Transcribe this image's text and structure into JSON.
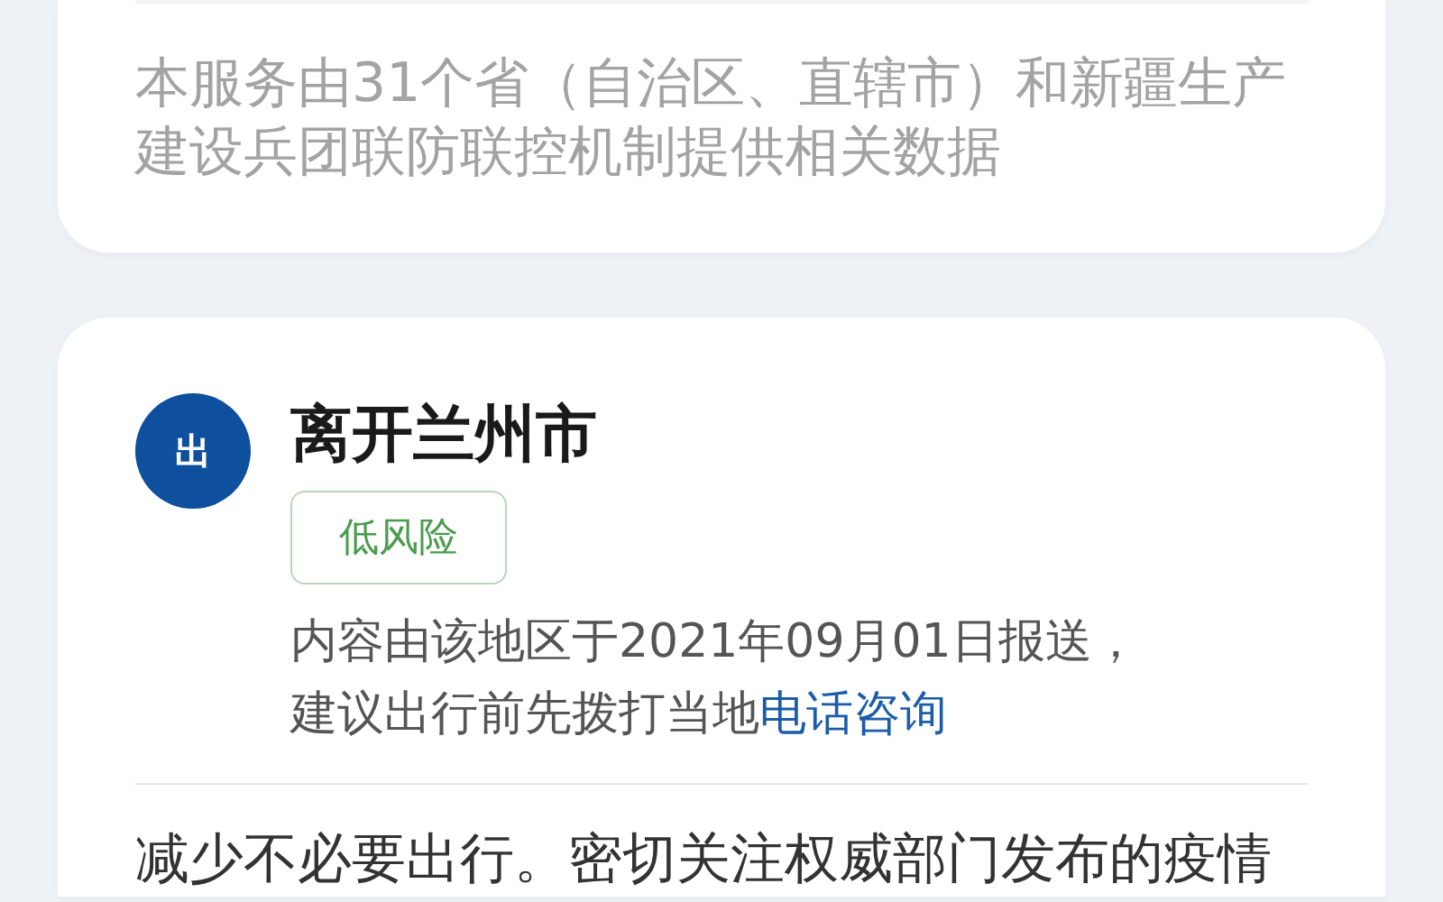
{
  "source_note": {
    "lines": [
      "本服务由31个省（自治区、直辖市）和新疆生产",
      "建设兵团联防联控机制提供相关数据"
    ]
  },
  "trip": {
    "badge": "出",
    "title": "离开兰州市",
    "risk": {
      "label": "低风险"
    },
    "notice": {
      "lines": [
        "内容由该地区于2021年09月01日报送，",
        "建议出行前先拨打当地"
      ],
      "link": "电话咨询"
    },
    "advice": "减少不必要出行。密切关注权威部门发布的疫情"
  }
}
